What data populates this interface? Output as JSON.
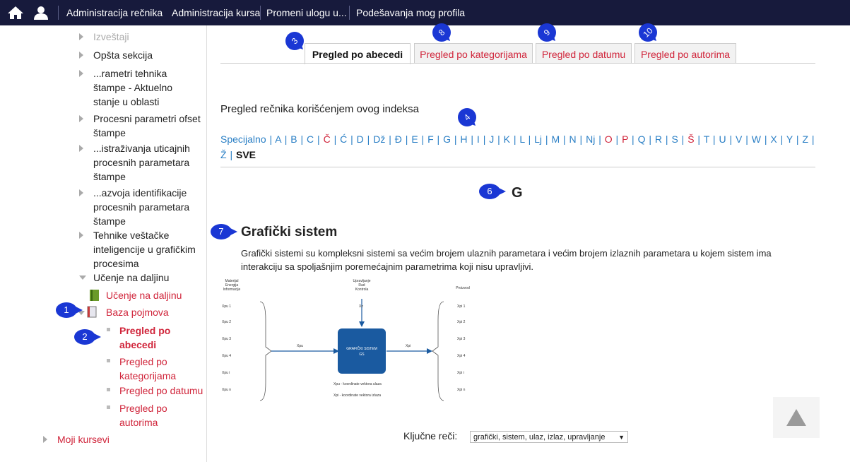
{
  "topbar": {
    "home_icon": "home-icon",
    "user_icon": "user-icon",
    "menu": [
      "Administracija rečnika",
      "Administracija kursa",
      "Promeni ulogu u...",
      "Podešavanja mog profila"
    ]
  },
  "sidebar": {
    "items": [
      "Izveštaji",
      "Opšta sekcija",
      "...rametri tehnika štampe - Aktuelno stanje u oblasti",
      "Procesni parametri ofset štampe",
      "...istraživanja uticajnih procesnih parametara štampe",
      "...azvoja identifikacije procesnih parametara štampe",
      "Tehnike veštačke inteligencije u grafičkim procesima",
      "Učenje na daljinu"
    ],
    "ucenje_link": "Učenje na daljinu",
    "baza": "Baza pojmova",
    "sub": [
      "Pregled po abecedi",
      "Pregled po kategorijama",
      "Pregled po datumu",
      "Pregled po autorima"
    ],
    "moji_kursevi": "Moji kursevi"
  },
  "badges": [
    "1",
    "2",
    "3",
    "4",
    "6",
    "7",
    "8",
    "9",
    "10"
  ],
  "tabs": [
    "Pregled po abecedi",
    "Pregled po kategorijama",
    "Pregled po datumu",
    "Pregled po autorima"
  ],
  "index_heading": "Pregled rečnika korišćenjem ovog indeksa",
  "letters": [
    "Specijalno",
    "A",
    "B",
    "C",
    "Č",
    "Ć",
    "D",
    "Dž",
    "Đ",
    "E",
    "F",
    "G",
    "H",
    "I",
    "J",
    "K",
    "L",
    "Lj",
    "M",
    "N",
    "Nj",
    "O",
    "P",
    "Q",
    "R",
    "S",
    "Š",
    "T",
    "U",
    "V",
    "W",
    "X",
    "Y",
    "Z",
    "Ž",
    "SVE"
  ],
  "red_letters": [
    "Č",
    "O",
    "P",
    "Š"
  ],
  "current_letter": "G",
  "entry": {
    "title": "Grafički sistem",
    "definition": "Grafički sistemi su kompleksni sistemi sa većim brojem ulaznih parametara i većim brojem izlaznih parametara u kojem sistem ima interakciju sa spoljašnjim poremećajnim parametrima koji nisu upravljivi.",
    "keywords_label": "Ključne reči:",
    "keywords_value": "grafički, sistem, ulaz, izlaz, upravljanje"
  },
  "diagram": {
    "left_title": [
      "Materijal",
      "Energija",
      "Informacije"
    ],
    "top_title": [
      "Upravljanje",
      "Rad",
      "Kontrola"
    ],
    "right_title": "Proizvod",
    "inputs": [
      "Xpu 1",
      "Xpu 2",
      "Xpu 3",
      "Xpu 4",
      "Xpu i",
      "Xpu n"
    ],
    "outputs": [
      "Xpi 1",
      "Xpi 2",
      "Xpi 3",
      "Xpi 4",
      "Xpi i",
      "Xpi n"
    ],
    "box": [
      "GRAFIČKI SISTEM",
      "GS"
    ],
    "in_arrow": "Xpu",
    "out_arrow": "Xpi",
    "top_arrow": "Xz",
    "legend": [
      "Xpu - koordinate vektora ulaza",
      "Xpi - koordinate vektora izlaza"
    ]
  },
  "colors": {
    "topbar": "#171a3c",
    "accent_red": "#d0243a",
    "link_blue": "#2a7fc5",
    "badge": "#1a37d4",
    "box": "#1a5aa0"
  }
}
